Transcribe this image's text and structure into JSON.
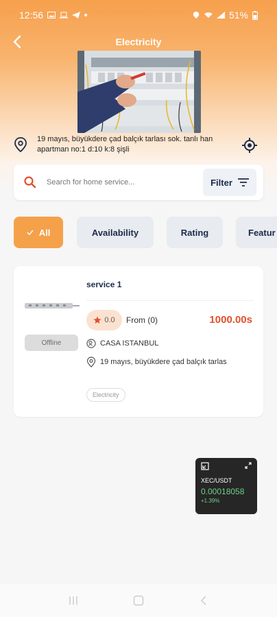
{
  "status_bar": {
    "time": "12:56",
    "battery": "51%"
  },
  "header": {
    "title": "Electricity"
  },
  "address": {
    "text": "19 mayıs, büyükdere çad balçık tarlası sok. tanlı han apartman no:1 d:10 k:8 şişli"
  },
  "search": {
    "placeholder": "Search for home service...",
    "filter_label": "Filter"
  },
  "chips": [
    {
      "label": "All",
      "active": true
    },
    {
      "label": "Availability",
      "active": false
    },
    {
      "label": "Rating",
      "active": false
    },
    {
      "label": "Featur",
      "active": false
    }
  ],
  "service": {
    "title": "service 1",
    "status": "Offline",
    "rating": "0.0",
    "from": "From (0)",
    "price": "1000.00s",
    "provider": "CASA ISTANBUL",
    "address": "19 mayıs, büyükdere çad balçık tarlas",
    "tag": "Electricity"
  },
  "ticker": {
    "pair": "XEC/USDT",
    "price": "0.00018058",
    "change": "+1.39%"
  },
  "colors": {
    "accent": "#f4a14a",
    "price": "#e1502a",
    "navy": "#1c2b4a"
  }
}
